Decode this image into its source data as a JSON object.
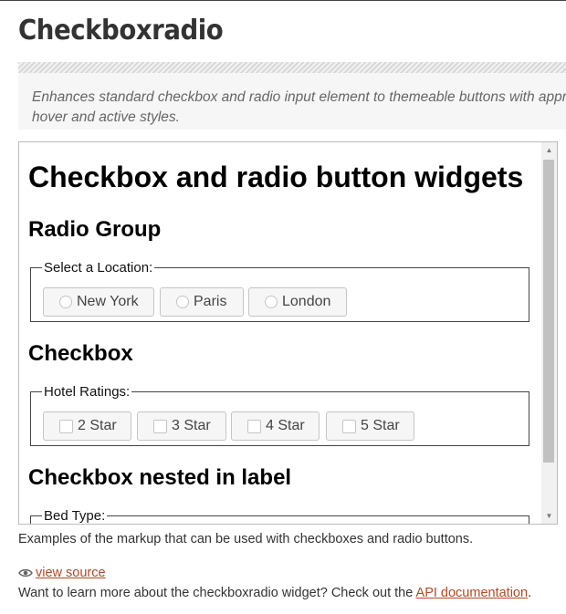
{
  "page": {
    "title": "Checkboxradio",
    "description": "Enhances standard checkbox and radio input element to themeable buttons with appropriate hover and active styles.",
    "caption": "Examples of the markup that can be used with checkboxes and radio buttons.",
    "view_source": "view source",
    "learn_more_prefix": "Want to learn more about the checkboxradio widget? Check out the",
    "learn_more_link": "API documentation",
    "learn_more_suffix": "."
  },
  "demo": {
    "heading": "Checkbox and radio button widgets",
    "radio_group": {
      "heading": "Radio Group",
      "legend": "Select a Location:",
      "options": [
        "New York",
        "Paris",
        "London"
      ]
    },
    "checkbox": {
      "heading": "Checkbox",
      "legend": "Hotel Ratings:",
      "options": [
        "2 Star",
        "3 Star",
        "4 Star",
        "5 Star"
      ]
    },
    "nested": {
      "heading": "Checkbox nested in label",
      "legend": "Bed Type:"
    }
  },
  "colors": {
    "link": "#b24926",
    "button_bg": "#f6f6f6",
    "button_border": "#c5c5c5"
  }
}
